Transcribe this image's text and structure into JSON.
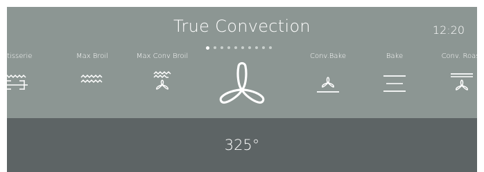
{
  "header": {
    "title": "True Convection",
    "clock": "12:20"
  },
  "pager": {
    "count": 10,
    "active_index": 0
  },
  "modes": [
    {
      "label": "Rotisserie",
      "icon": "rotisserie-icon"
    },
    {
      "label": "Max Broil",
      "icon": "broil-icon"
    },
    {
      "label": "Max Conv Broil",
      "icon": "conv-broil-icon"
    },
    {
      "label": "",
      "icon": "fan-icon"
    },
    {
      "label": "Conv.Bake",
      "icon": "conv-bake-icon"
    },
    {
      "label": "Bake",
      "icon": "bake-icon"
    },
    {
      "label": "Conv. Roast",
      "icon": "conv-roast-icon"
    }
  ],
  "temperature": {
    "value": "325°"
  },
  "colors": {
    "panel": "#8c9693",
    "footer": "#5d6465",
    "text": "#ffffff"
  }
}
